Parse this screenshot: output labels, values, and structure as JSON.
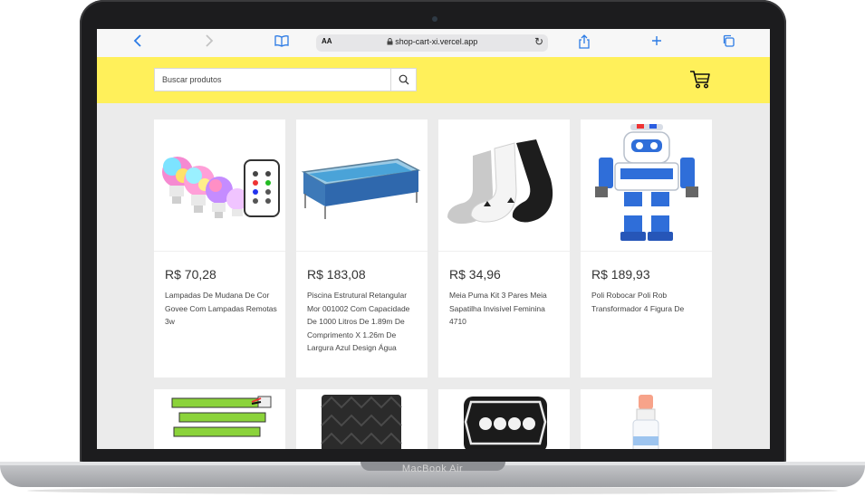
{
  "device": {
    "brand": "MacBook Air"
  },
  "browser": {
    "url": "shop-cart-xi.vercel.app",
    "aa_label": "AA"
  },
  "header": {
    "search_placeholder": "Buscar produtos",
    "accent_color": "#fff05a"
  },
  "products": [
    {
      "price": "R$ 70,28",
      "title": "Lampadas De Mudana De Cor Govee Com Lampadas Remotas 3w",
      "image": "smart-bulbs-with-remote"
    },
    {
      "price": "R$ 183,08",
      "title": "Piscina Estrutural Retangular Mor 001002 Com Capacidade De 1000 Litros De 1.89m De Comprimento X 1.26m De Largura Azul Design Água",
      "image": "rectangular-pool"
    },
    {
      "price": "R$ 34,96",
      "title": "Meia Puma Kit 3 Pares Meia Sapatilha Invisível Feminina 4710",
      "image": "socks-three-pairs"
    },
    {
      "price": "R$ 189,93",
      "title": "Poli Robocar Poli Rob Transformador 4 Figura De",
      "image": "robot-toy"
    },
    {
      "price": "",
      "title": "",
      "image": "batteries"
    },
    {
      "price": "",
      "title": "",
      "image": "external-hard-drive"
    },
    {
      "price": "",
      "title": "",
      "image": "led-headlight"
    },
    {
      "price": "",
      "title": "",
      "image": "spray-bottle"
    }
  ]
}
